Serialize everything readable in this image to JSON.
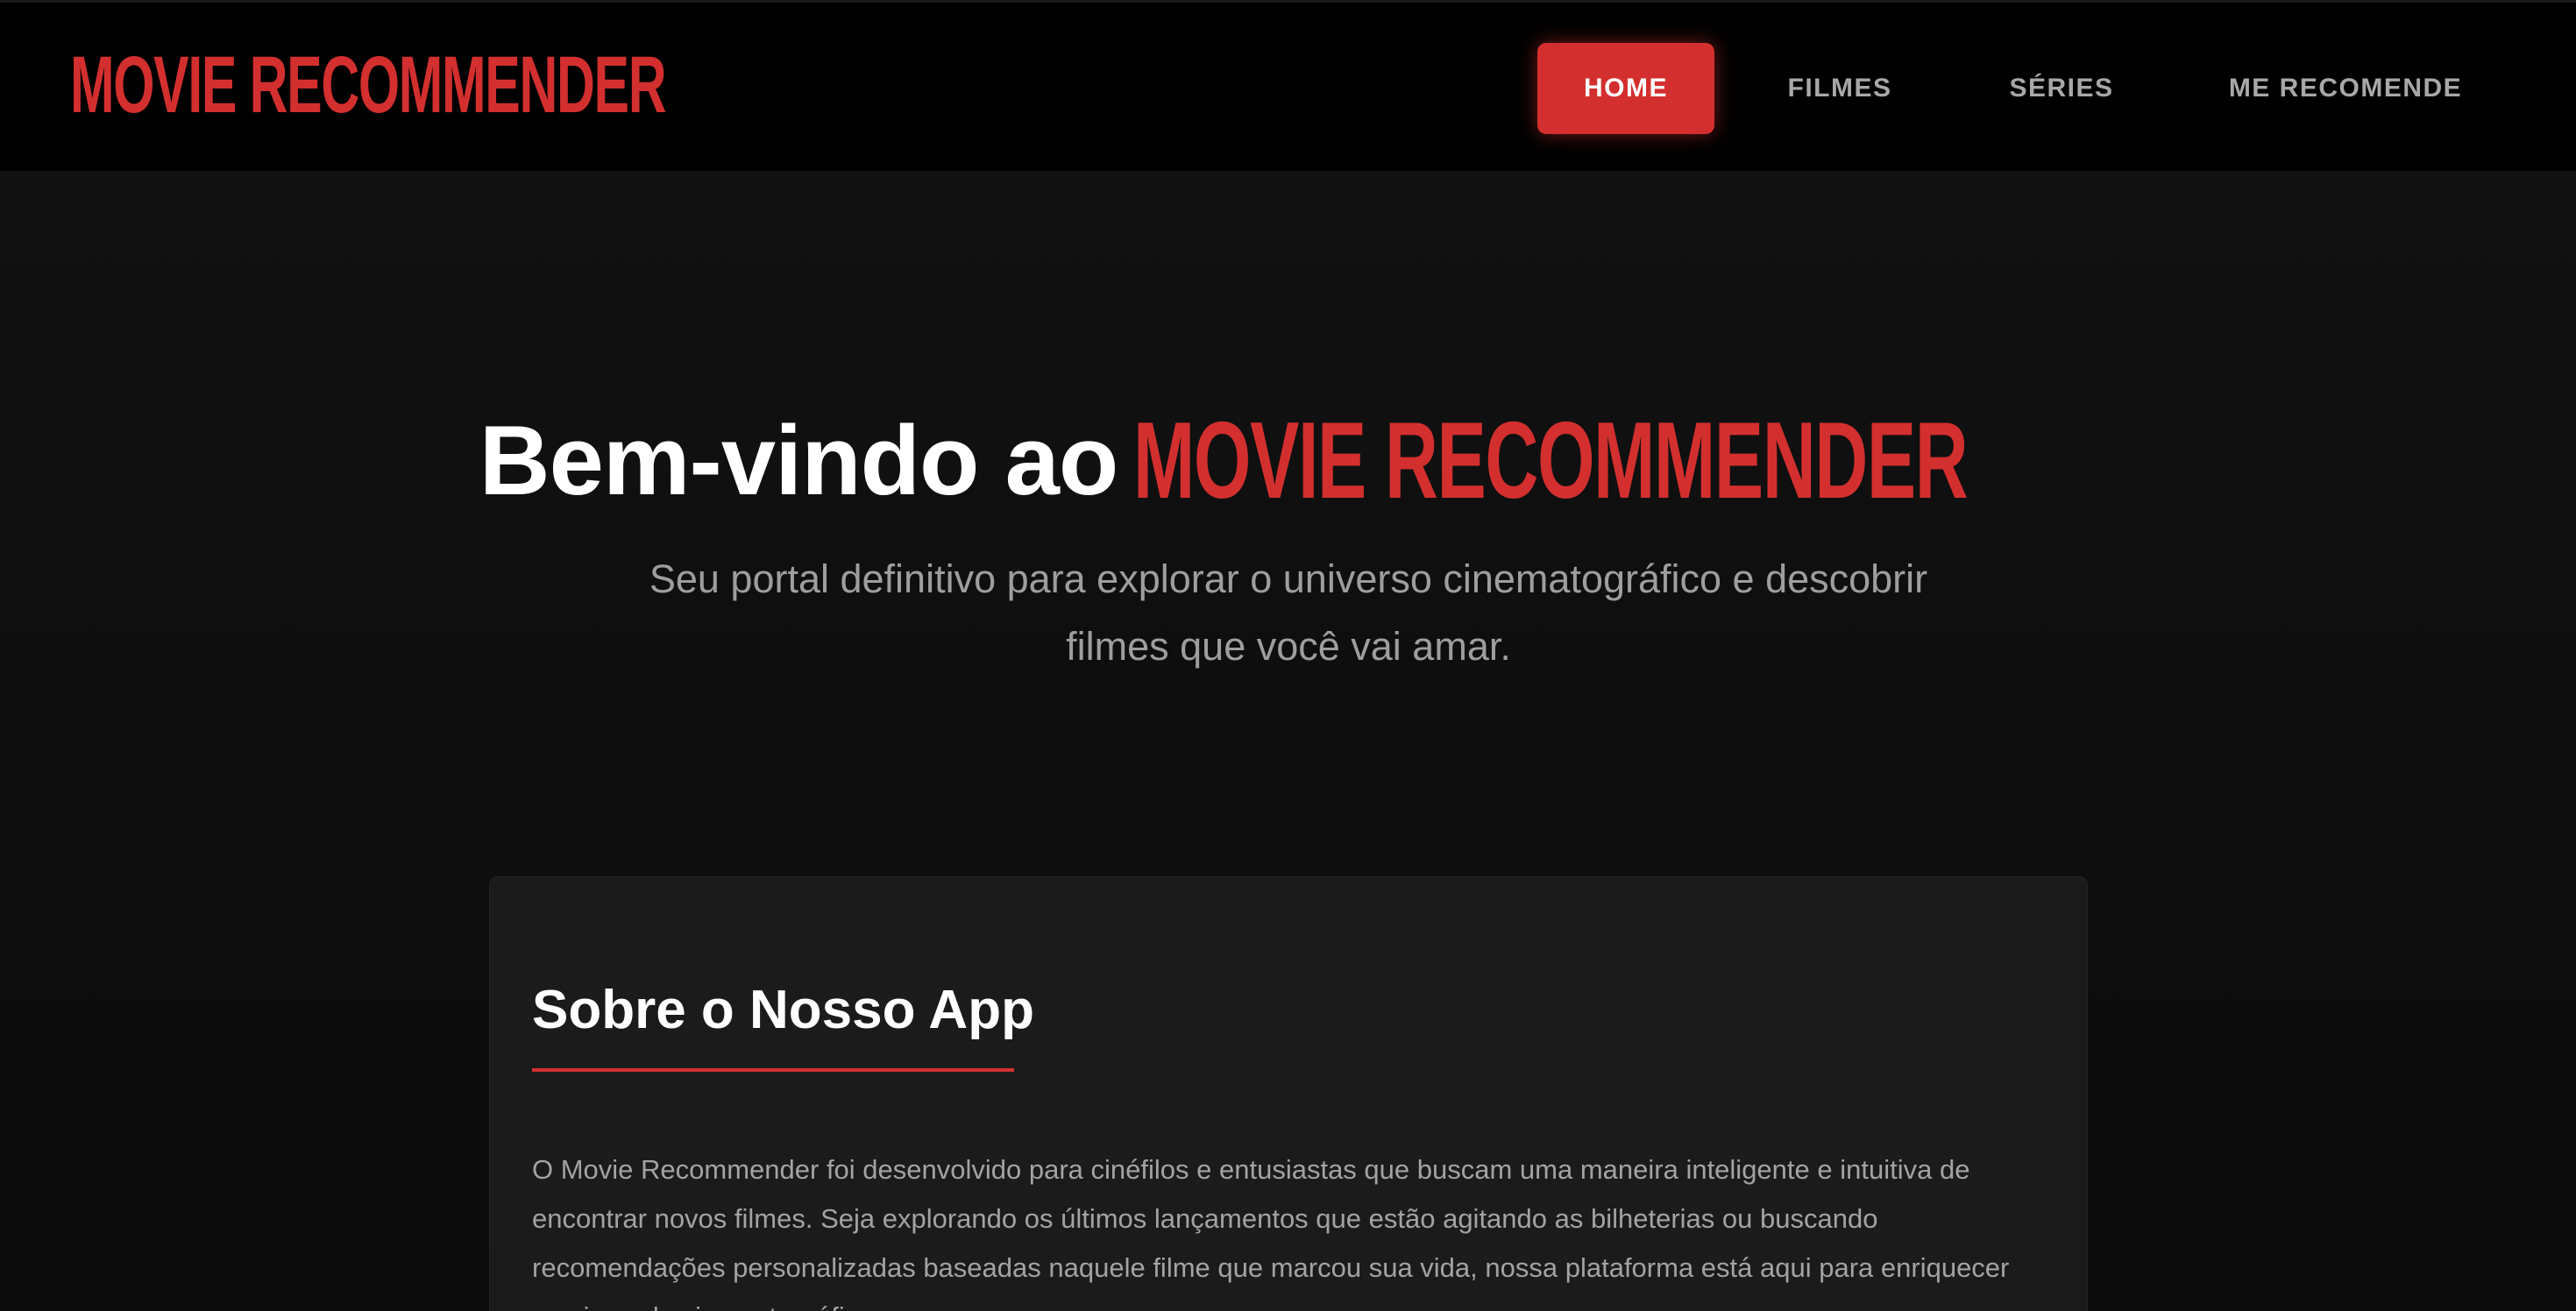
{
  "brand": {
    "name": "MOVIE RECOMMENDER",
    "accent_color": "#d32f2f"
  },
  "nav": {
    "items": [
      {
        "label": "HOME",
        "active": true
      },
      {
        "label": "FILMES",
        "active": false
      },
      {
        "label": "SÉRIES",
        "active": false
      },
      {
        "label": "ME RECOMENDE",
        "active": false
      }
    ]
  },
  "hero": {
    "title_prefix": "Bem-vindo ao",
    "title_brand": "MOVIE RECOMMENDER",
    "subtitle": "Seu portal definitivo para explorar o universo cinematográfico e descobrir filmes que você vai amar."
  },
  "about": {
    "title": "Sobre o Nosso App",
    "text": "O Movie Recommender foi desenvolvido para cinéfilos e entusiastas que buscam uma maneira inteligente e intuitiva de encontrar novos filmes. Seja explorando os últimos lançamentos que estão agitando as bilheterias ou buscando recomendações personalizadas baseadas naquele filme que marcou sua vida, nossa plataforma está aqui para enriquecer sua jornada cinematográfica."
  },
  "colors": {
    "background": "#0d0d0d",
    "header": "#000000",
    "card": "#1b1b1b",
    "nav_text": "#a8a8a8",
    "muted_text": "#9e9e9e"
  }
}
